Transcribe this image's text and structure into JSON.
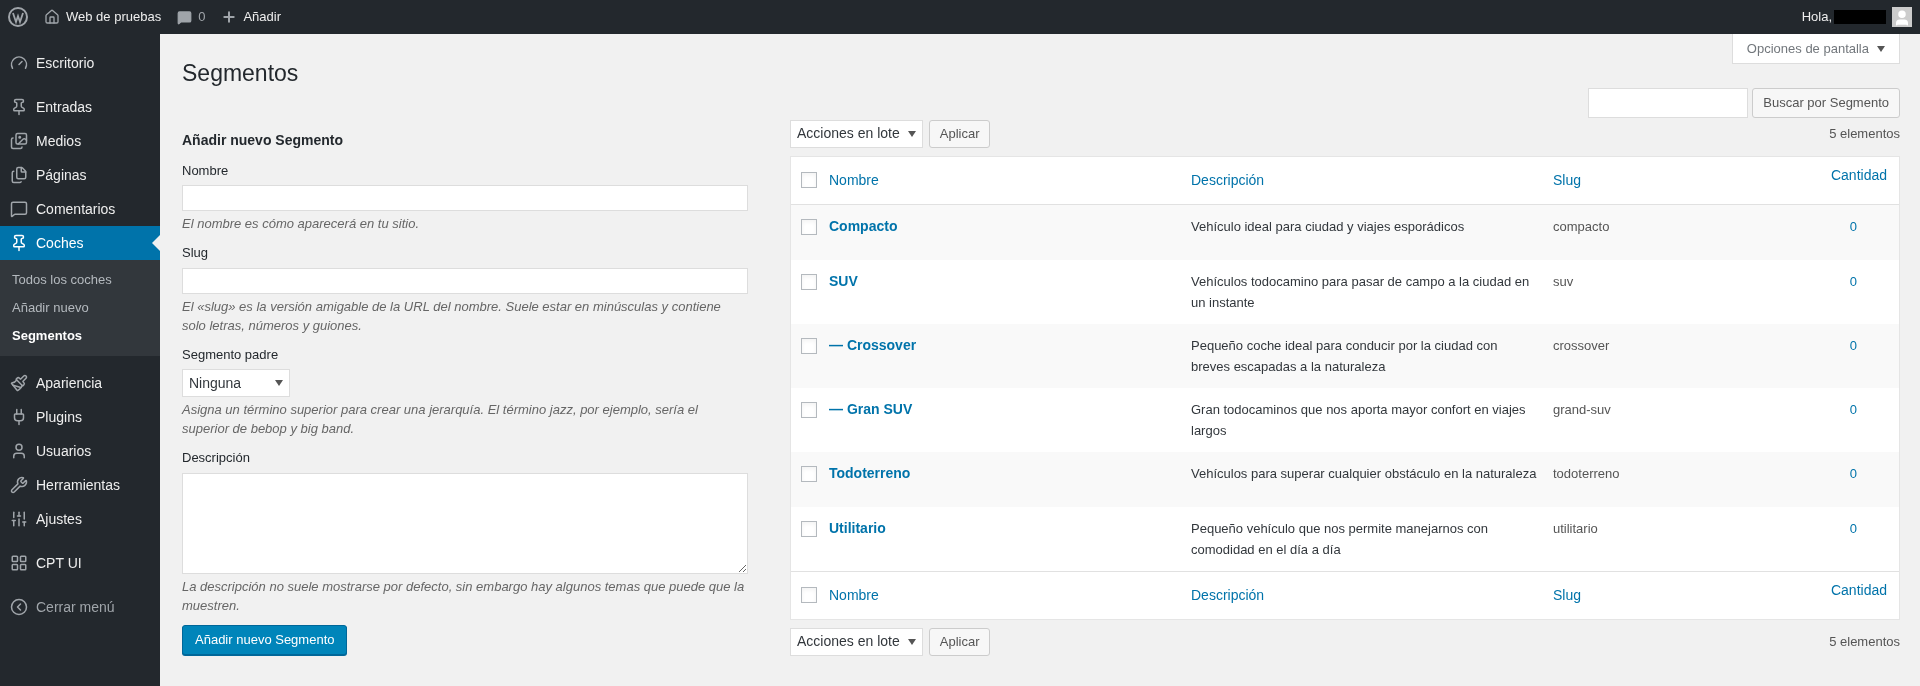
{
  "admin_bar": {
    "site_name": "Web de pruebas",
    "comments_count": "0",
    "new_label": "Añadir",
    "greeting": "Hola,"
  },
  "sidebar": {
    "groups": [
      [
        {
          "label": "Escritorio",
          "selected": false
        }
      ],
      [
        {
          "label": "Entradas",
          "selected": false
        },
        {
          "label": "Medios",
          "selected": false
        },
        {
          "label": "Páginas",
          "selected": false
        },
        {
          "label": "Comentarios",
          "selected": false
        },
        {
          "label": "Coches",
          "selected": true,
          "expanded": true,
          "children": [
            {
              "label": "Todos los coches",
              "selected": false
            },
            {
              "label": "Añadir nuevo",
              "selected": false
            },
            {
              "label": "Segmentos",
              "selected": true
            }
          ]
        }
      ],
      [
        {
          "label": "Apariencia",
          "selected": false
        },
        {
          "label": "Plugins",
          "selected": false
        },
        {
          "label": "Usuarios",
          "selected": false
        },
        {
          "label": "Herramientas",
          "selected": false
        },
        {
          "label": "Ajustes",
          "selected": false
        }
      ],
      [
        {
          "label": "CPT UI",
          "selected": false
        }
      ]
    ],
    "collapse_label": "Cerrar menú"
  },
  "page_title": "Segmentos",
  "screen_options": "Opciones de pantalla",
  "search_button": "Buscar por Segmento",
  "form": {
    "heading": "Añadir nuevo Segmento",
    "fields": [
      {
        "kind": "text",
        "label": "Nombre",
        "help": "El nombre es cómo aparecerá en tu sitio."
      },
      {
        "kind": "text",
        "label": "Slug",
        "help": "El «slug» es la versión amigable de la URL del nombre. Suele estar en minúsculas y contiene solo letras, números y guiones."
      },
      {
        "kind": "select",
        "label": "Segmento padre",
        "value": "Ninguna",
        "help": "Asigna un término superior para crear una jerarquía. El término jazz, por ejemplo, sería el superior de bebop y big band."
      },
      {
        "kind": "textarea",
        "label": "Descripción",
        "help": "La descripción no suele mostrarse por defecto, sin embargo hay algunos temas que puede que la muestren."
      }
    ],
    "submit": "Añadir nuevo Segmento"
  },
  "top_actions": {
    "bulk": "Acciones en lote",
    "apply": "Aplicar",
    "count": "5 elementos"
  },
  "table": {
    "header_checked": false,
    "columns": [
      "Nombre",
      "Descripción",
      "Slug",
      "Cantidad"
    ],
    "rows": [
      {
        "name": "Compacto",
        "description": "Vehículo ideal para ciudad y viajes esporádicos",
        "slug": "compacto",
        "count": "0",
        "selected": false
      },
      {
        "name": "SUV",
        "description": "Vehículos todocamino para pasar de campo a la ciudad en un instante",
        "slug": "suv",
        "count": "0",
        "selected": false
      },
      {
        "name": "— Crossover",
        "description": "Pequeño coche ideal para conducir por la ciudad con breves escapadas a la naturaleza",
        "slug": "crossover",
        "count": "0",
        "selected": false
      },
      {
        "name": "— Gran SUV",
        "description": "Gran todocaminos que nos aporta mayor confort en viajes largos",
        "slug": "grand-suv",
        "count": "0",
        "selected": false
      },
      {
        "name": "Todoterreno",
        "description": "Vehículos para superar cualquier obstáculo en la naturaleza",
        "slug": "todoterreno",
        "count": "0",
        "selected": false
      },
      {
        "name": "Utilitario",
        "description": "Pequeño vehículo que nos permite manejarnos con comodidad en el día a día",
        "slug": "utilitario",
        "count": "0",
        "selected": false
      }
    ],
    "footer_checked": false,
    "footer_columns": [
      "Nombre",
      "Descripción",
      "Slug",
      "Cantidad"
    ]
  },
  "bottom_actions": {
    "bulk": "Acciones en lote",
    "apply": "Aplicar",
    "count": "5 elementos"
  }
}
